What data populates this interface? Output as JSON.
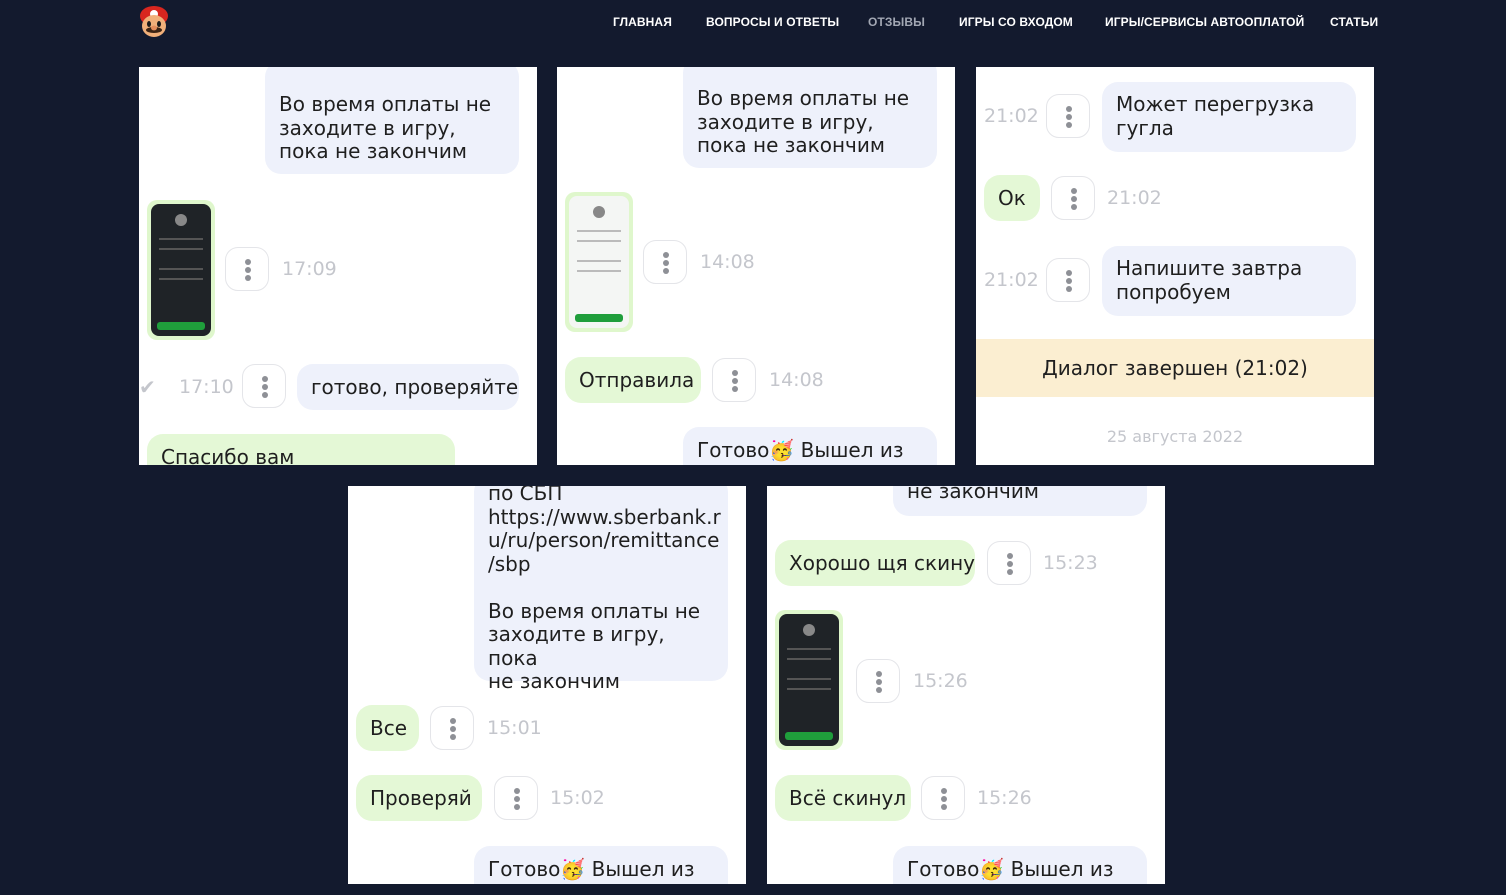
{
  "header": {
    "nav": [
      "ГЛАВНАЯ",
      "ВОПРОСЫ И ОТВЕТЫ",
      "ОТЗЫВЫ",
      "ИГРЫ СО ВХОДОМ",
      "ИГРЫ/СЕРВИСЫ АВТООПЛАТОЙ",
      "СТАТЬИ"
    ],
    "active": "ОТЗЫВЫ",
    "logo_icon": "mario-icon"
  },
  "colors": {
    "background": "#131a2e",
    "incoming_bubble": "#eef1fb",
    "outgoing_bubble": "#e4f8d6",
    "banner": "#fbeed1"
  },
  "reviews": [
    {
      "messages": {
        "m1": "Во время оплаты не заходите в игру, пока не закончим",
        "t1": "17:09",
        "t2": "17:10",
        "m2": "готово, проверяйте",
        "m3": "Спасибо вам"
      }
    },
    {
      "messages": {
        "m1": "Во время оплаты не заходите в игру, пока не закончим",
        "t1": "14:08",
        "m2": "Отправила",
        "t2": "14:08",
        "m3": "Готово",
        "m3_suffix": "Вышел из"
      }
    },
    {
      "messages": {
        "t1": "21:02",
        "m1": "Может перегрузка гугла",
        "m2": "Ок",
        "t2": "21:02",
        "t3": "21:02",
        "m3": "Напишите завтра попробуем",
        "banner": "Диалог завершен (21:02)",
        "date": "25 августа 2022"
      }
    },
    {
      "messages": {
        "m1": "по СБП\nhttps://www.sberbank.r\nu/ru/person/remittance\n/sbp\n\nВо время оплаты не\nзаходите в игру, пока\nне закончим",
        "m2": "Все",
        "t1": "15:01",
        "m3": "Проверяй",
        "t2": "15:02",
        "m4": "Готово",
        "m4_suffix": "Вышел из"
      }
    },
    {
      "messages": {
        "m1": "не закончим",
        "m2": "Хорошо щя скину",
        "t1": "15:23",
        "t2": "15:26",
        "m3": "Всё скинул",
        "t3": "15:26",
        "m4": "Готово",
        "m4_suffix": "Вышел из"
      }
    }
  ]
}
